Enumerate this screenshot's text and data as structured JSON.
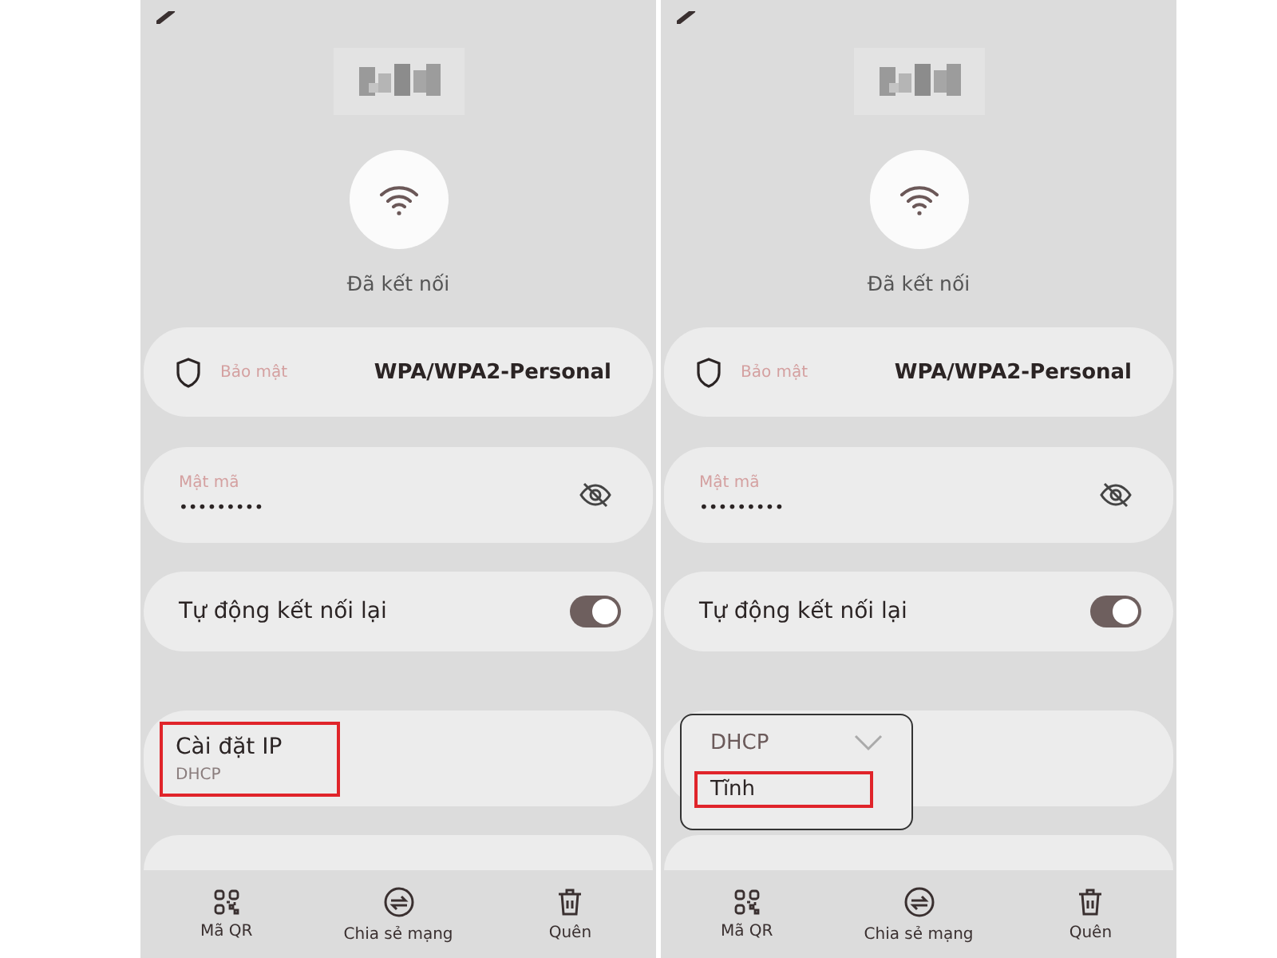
{
  "screens": [
    {
      "status": "Đã kết nối",
      "security": {
        "label": "Bảo mật",
        "value": "WPA/WPA2-Personal"
      },
      "password": {
        "label": "Mật mã",
        "value": "•••••••••"
      },
      "auto_reconnect": {
        "label": "Tự động kết nối lại",
        "on": true
      },
      "ip_settings": {
        "kind": "summary",
        "label": "Cài đặt IP",
        "value": "DHCP",
        "highlighted": true
      },
      "actions": [
        {
          "kind": "qr",
          "label": "Mã QR"
        },
        {
          "kind": "share",
          "label": "Chia sẻ mạng"
        },
        {
          "kind": "delete",
          "label": "Quên"
        }
      ]
    },
    {
      "status": "Đã kết nối",
      "security": {
        "label": "Bảo mật",
        "value": "WPA/WPA2-Personal"
      },
      "password": {
        "label": "Mật mã",
        "value": "•••••••••"
      },
      "auto_reconnect": {
        "label": "Tự động kết nối lại",
        "on": true
      },
      "ip_settings": {
        "kind": "dropdown",
        "options": [
          {
            "label": "DHCP",
            "selected": true,
            "highlighted": false
          },
          {
            "label": "Tĩnh",
            "selected": false,
            "highlighted": true
          }
        ]
      },
      "actions": [
        {
          "kind": "qr",
          "label": "Mã QR"
        },
        {
          "kind": "share",
          "label": "Chia sẻ mạng"
        },
        {
          "kind": "delete",
          "label": "Quên"
        }
      ]
    }
  ]
}
